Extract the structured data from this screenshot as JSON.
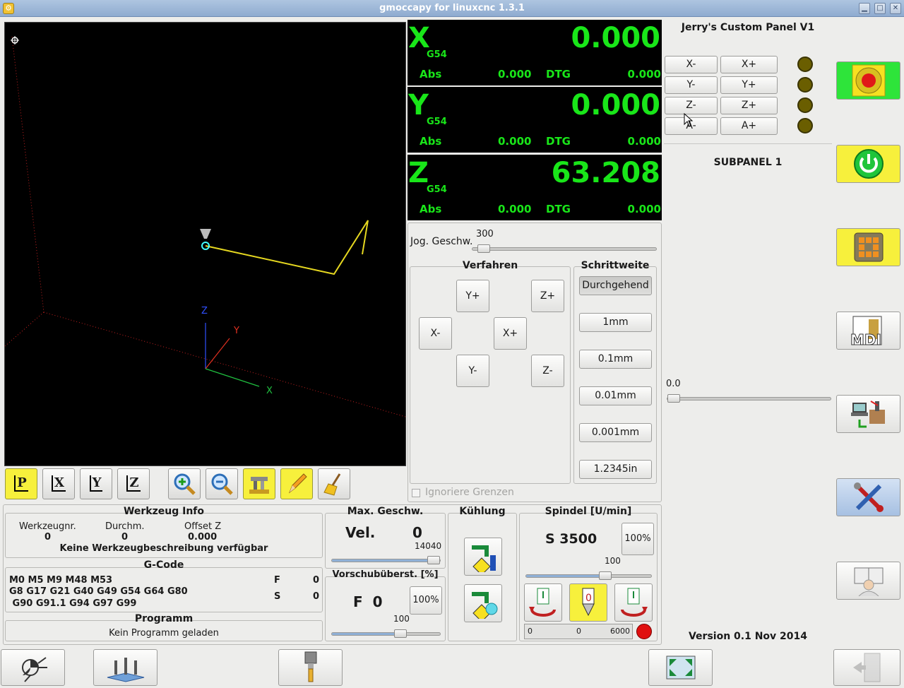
{
  "window": {
    "title": "gmoccapy for linuxcnc     1.3.1"
  },
  "preview": {
    "axis_labels": {
      "x": "X",
      "y": "Y",
      "z": "Z"
    },
    "toolbar": [
      {
        "name": "view-p-button",
        "label": "P",
        "active": true
      },
      {
        "name": "view-x-button",
        "label": "X",
        "active": false
      },
      {
        "name": "view-y-button",
        "label": "Y",
        "active": false
      },
      {
        "name": "view-z-button",
        "label": "Z",
        "active": false
      },
      {
        "name": "zoom-in-button",
        "icon": "zoom-in-icon"
      },
      {
        "name": "zoom-out-button",
        "icon": "zoom-out-icon"
      },
      {
        "name": "dimensions-button",
        "icon": "caliper-icon"
      },
      {
        "name": "tool-path-button",
        "icon": "pencil-icon"
      },
      {
        "name": "clear-plot-button",
        "icon": "broom-icon"
      }
    ]
  },
  "dro": [
    {
      "axis": "X",
      "coord": "G54",
      "value": "0.000",
      "abs_label": "Abs",
      "abs": "0.000",
      "dtg_label": "DTG",
      "dtg": "0.000"
    },
    {
      "axis": "Y",
      "coord": "G54",
      "value": "0.000",
      "abs_label": "Abs",
      "abs": "0.000",
      "dtg_label": "DTG",
      "dtg": "0.000"
    },
    {
      "axis": "Z",
      "coord": "G54",
      "value": "63.208",
      "abs_label": "Abs",
      "abs": "0.000",
      "dtg_label": "DTG",
      "dtg": "0.000"
    }
  ],
  "jog": {
    "speed_label": "Jog. Geschw.",
    "speed_value": "300",
    "speed_fraction": 0.03,
    "verfahren_title": "Verfahren",
    "buttons": {
      "yplus": "Y+",
      "zplus": "Z+",
      "xminus": "X-",
      "xplus": "X+",
      "yminus": "Y-",
      "zminus": "Z-"
    },
    "schrittweite_title": "Schrittweite",
    "increments": [
      "Durchgehend",
      "1mm",
      "0.1mm",
      "0.01mm",
      "0.001mm",
      "1.2345in"
    ],
    "ignore_limits": "Ignoriere Grenzen"
  },
  "custom_panel": {
    "title": "Jerry's Custom Panel V1",
    "buttons": [
      [
        "X-",
        "X+"
      ],
      [
        "Y-",
        "Y+"
      ],
      [
        "Z-",
        "Z+"
      ],
      [
        "A-",
        "A+"
      ]
    ],
    "subpanel_title": "SUBPANEL 1",
    "slider_value": "0.0",
    "version": "Version 0.1 Nov 2014"
  },
  "tool_info": {
    "title": "Werkzeug Info",
    "cols": [
      "Werkzeugnr.",
      "Durchm.",
      "Offset Z"
    ],
    "vals": [
      "0",
      "0",
      "0.000"
    ],
    "description": "Keine Werkzeugbeschreibung verfügbar"
  },
  "gcode": {
    "title": "G-Code",
    "line1": "M0 M5 M9 M48 M53",
    "line2": "G8 G17 G21 G40 G49 G54 G64 G80",
    "line3": " G90 G91.1 G94 G97 G99",
    "f_label": "F",
    "f_value": "0",
    "s_label": "S",
    "s_value": "0"
  },
  "program": {
    "title": "Programm",
    "status": "Kein Programm geladen"
  },
  "max_vel": {
    "title": "Max. Geschw.",
    "label": "Vel.",
    "value": "0",
    "max": "14040",
    "fraction": 1.0
  },
  "feed_override": {
    "title": "Vorschubüberst. [%]",
    "label": "F  0",
    "reset": "100%",
    "value": "100",
    "fraction": 0.65
  },
  "coolant": {
    "title": "Kühlung"
  },
  "spindle": {
    "title": "Spindel [U/min]",
    "speed": "S 3500",
    "reset": "100%",
    "override": "100",
    "override_fraction": 0.65,
    "bar_min": "0",
    "bar_value": "0",
    "bar_max": "6000"
  },
  "colors": {
    "dro_green": "#19e619",
    "active_yellow": "#f7f03c",
    "estop_green": "#2ee43a"
  }
}
